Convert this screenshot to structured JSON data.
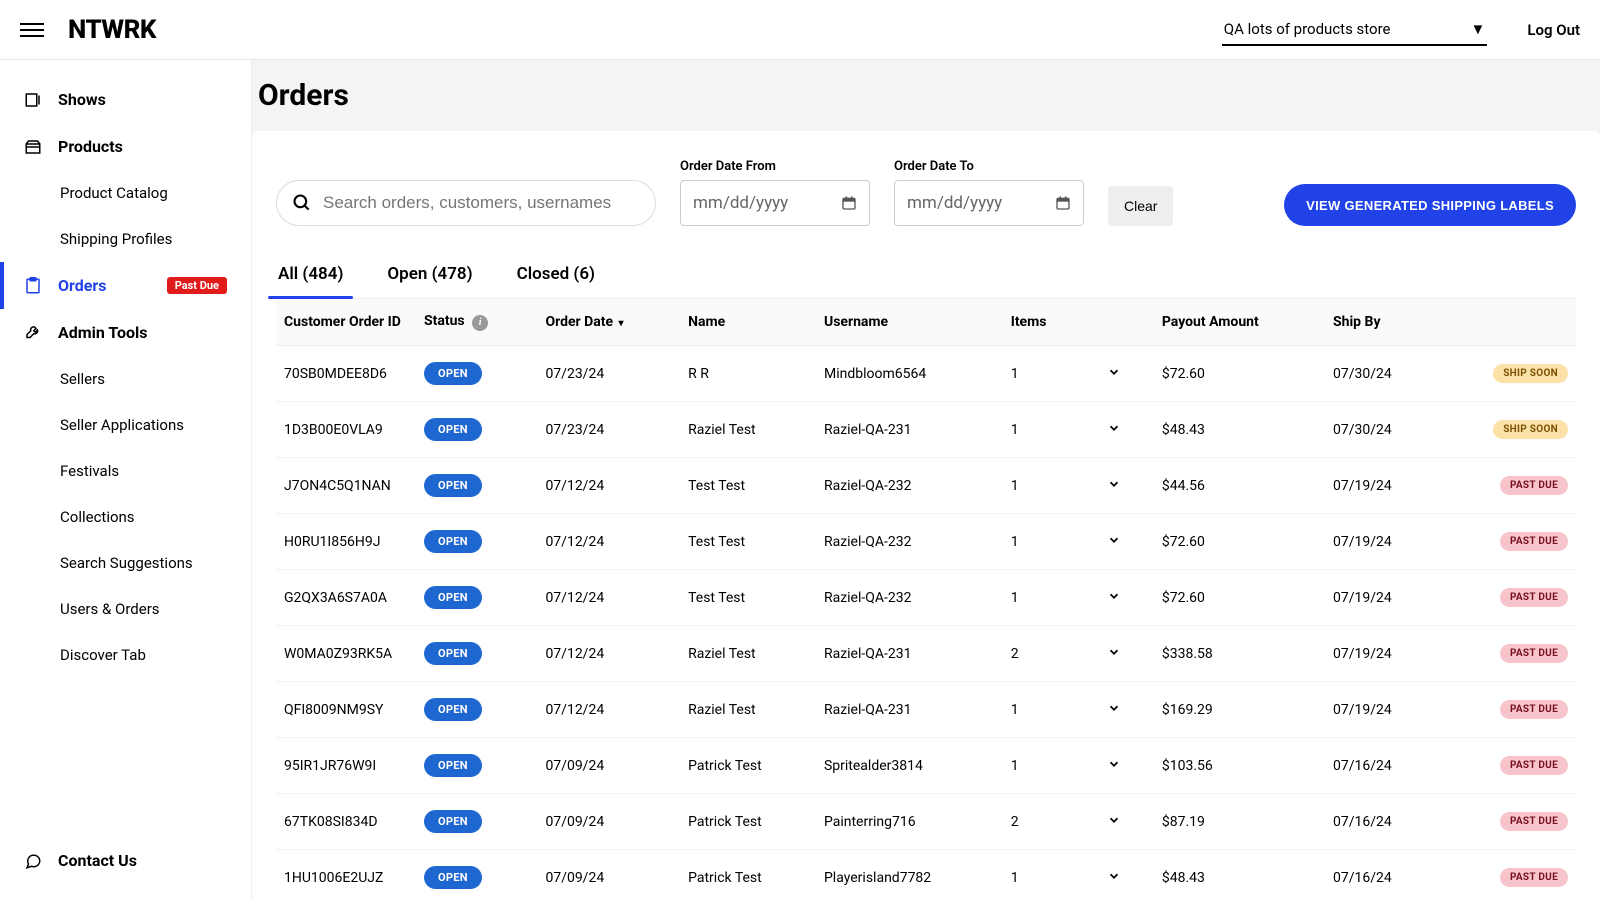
{
  "topbar": {
    "logo": "NTWRK",
    "store_selected": "QA lots of products store",
    "logout": "Log Out"
  },
  "sidebar": {
    "shows": "Shows",
    "products": "Products",
    "product_catalog": "Product Catalog",
    "shipping_profiles": "Shipping Profiles",
    "orders": "Orders",
    "orders_badge": "Past Due",
    "admin_tools": "Admin Tools",
    "sellers": "Sellers",
    "seller_applications": "Seller Applications",
    "festivals": "Festivals",
    "collections": "Collections",
    "search_suggestions": "Search Suggestions",
    "users_orders": "Users & Orders",
    "discover_tab": "Discover Tab",
    "contact_us": "Contact Us"
  },
  "page": {
    "title": "Orders",
    "search_placeholder": "Search orders, customers, usernames",
    "date_from_label": "Order Date From",
    "date_to_label": "Order Date To",
    "date_placeholder": "mm/dd/yyyy",
    "clear": "Clear",
    "generate_labels": "VIEW GENERATED SHIPPING LABELS"
  },
  "tabs": {
    "all": "All (484)",
    "open": "Open (478)",
    "closed": "Closed (6)"
  },
  "columns": {
    "id": "Customer Order ID",
    "status": "Status",
    "order_date": "Order Date",
    "name": "Name",
    "username": "Username",
    "items": "Items",
    "payout": "Payout Amount",
    "ship_by": "Ship By"
  },
  "status_labels": {
    "open": "OPEN",
    "ship_soon": "SHIP SOON",
    "past_due": "PAST DUE"
  },
  "orders": [
    {
      "id": "70SB0MDEE8D6",
      "status": "open",
      "date": "07/23/24",
      "name": "R R",
      "username": "Mindbloom6564",
      "items": "1",
      "payout": "$72.60",
      "ship": "07/30/24",
      "flag": "ship_soon"
    },
    {
      "id": "1D3B00E0VLA9",
      "status": "open",
      "date": "07/23/24",
      "name": "Raziel Test",
      "username": "Raziel-QA-231",
      "items": "1",
      "payout": "$48.43",
      "ship": "07/30/24",
      "flag": "ship_soon"
    },
    {
      "id": "J7ON4C5Q1NAN",
      "status": "open",
      "date": "07/12/24",
      "name": "Test Test",
      "username": "Raziel-QA-232",
      "items": "1",
      "payout": "$44.56",
      "ship": "07/19/24",
      "flag": "past_due"
    },
    {
      "id": "H0RU1I856H9J",
      "status": "open",
      "date": "07/12/24",
      "name": "Test Test",
      "username": "Raziel-QA-232",
      "items": "1",
      "payout": "$72.60",
      "ship": "07/19/24",
      "flag": "past_due"
    },
    {
      "id": "G2QX3A6S7A0A",
      "status": "open",
      "date": "07/12/24",
      "name": "Test Test",
      "username": "Raziel-QA-232",
      "items": "1",
      "payout": "$72.60",
      "ship": "07/19/24",
      "flag": "past_due"
    },
    {
      "id": "W0MA0Z93RK5A",
      "status": "open",
      "date": "07/12/24",
      "name": "Raziel Test",
      "username": "Raziel-QA-231",
      "items": "2",
      "payout": "$338.58",
      "ship": "07/19/24",
      "flag": "past_due"
    },
    {
      "id": "QFI8009NM9SY",
      "status": "open",
      "date": "07/12/24",
      "name": "Raziel Test",
      "username": "Raziel-QA-231",
      "items": "1",
      "payout": "$169.29",
      "ship": "07/19/24",
      "flag": "past_due"
    },
    {
      "id": "95IR1JR76W9I",
      "status": "open",
      "date": "07/09/24",
      "name": "Patrick Test",
      "username": "Spritealder3814",
      "items": "1",
      "payout": "$103.56",
      "ship": "07/16/24",
      "flag": "past_due"
    },
    {
      "id": "67TK08SI834D",
      "status": "open",
      "date": "07/09/24",
      "name": "Patrick Test",
      "username": "Painterring716",
      "items": "2",
      "payout": "$87.19",
      "ship": "07/16/24",
      "flag": "past_due"
    },
    {
      "id": "1HU1006E2UJZ",
      "status": "open",
      "date": "07/09/24",
      "name": "Patrick Test",
      "username": "Playerisland7782",
      "items": "1",
      "payout": "$48.43",
      "ship": "07/16/24",
      "flag": "past_due"
    }
  ]
}
